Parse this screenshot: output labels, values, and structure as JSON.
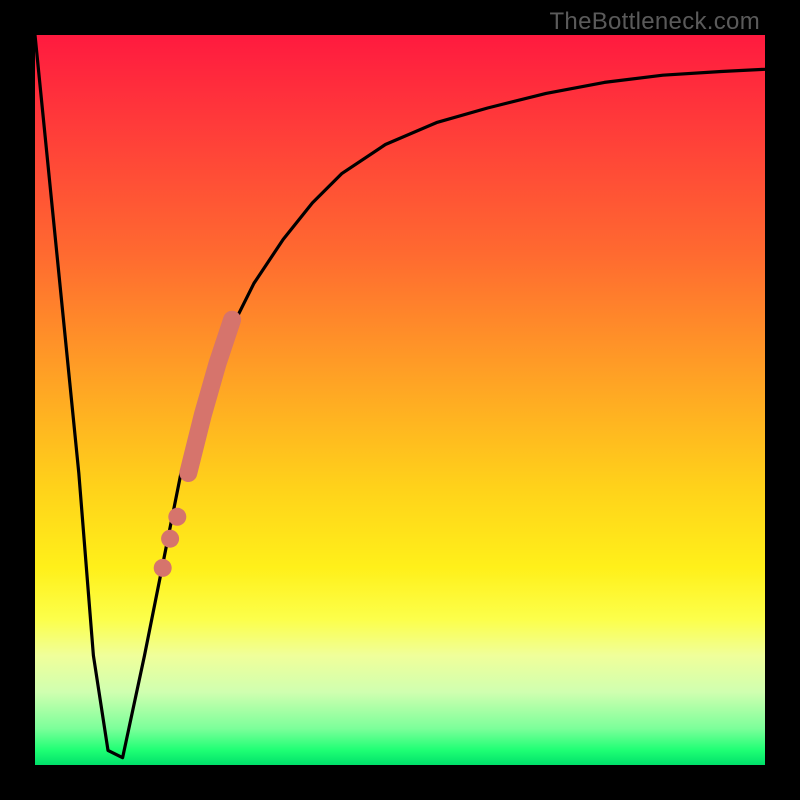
{
  "watermark": "TheBottleneck.com",
  "colors": {
    "line": "#000000",
    "marker": "#d6746c",
    "frame": "#000000"
  },
  "chart_data": {
    "type": "line",
    "title": "",
    "xlabel": "",
    "ylabel": "",
    "xlim": [
      0,
      100
    ],
    "ylim": [
      0,
      100
    ],
    "grid": false,
    "series": [
      {
        "name": "bottleneck-curve",
        "x": [
          0,
          3,
          6,
          8,
          10,
          12,
          15,
          18,
          20,
          23,
          26,
          30,
          34,
          38,
          42,
          48,
          55,
          62,
          70,
          78,
          86,
          94,
          100
        ],
        "y": [
          100,
          70,
          40,
          15,
          2,
          1,
          15,
          30,
          40,
          50,
          58,
          66,
          72,
          77,
          81,
          85,
          88,
          90,
          92,
          93.5,
          94.5,
          95,
          95.3
        ]
      }
    ],
    "markers": {
      "name": "highlight-dots",
      "x": [
        17.5,
        18.5,
        19.5,
        21,
        23,
        25,
        27
      ],
      "y": [
        27,
        31,
        34,
        40,
        48,
        55,
        61
      ]
    }
  }
}
